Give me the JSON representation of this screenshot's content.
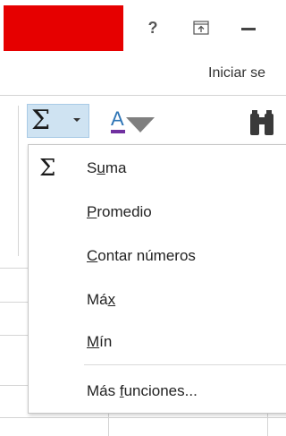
{
  "titlebar": {
    "help_icon_glyph": "?",
    "icons": [
      "help-icon",
      "ribbon-display-options-icon",
      "minimize-icon"
    ],
    "brand_block_color": "#e60000"
  },
  "account": {
    "sign_in_label": "Iniciar se"
  },
  "ribbon": {
    "autosum_icon": "sigma-icon",
    "fill_icon": "fill-down-icon",
    "find_icon": "binoculars-icon",
    "autosum_glyph": "Σ",
    "highlight_color": "#cfe3f2"
  },
  "menu": {
    "items": [
      {
        "id": "sum",
        "pre": "S",
        "ul": "u",
        "post": "ma",
        "icon": "sigma-icon",
        "glyph": "Σ"
      },
      {
        "id": "average",
        "pre": "",
        "ul": "P",
        "post": "romedio"
      },
      {
        "id": "count",
        "pre": "",
        "ul": "C",
        "post": "ontar números"
      },
      {
        "id": "max",
        "pre": "Má",
        "ul": "x",
        "post": ""
      },
      {
        "id": "min",
        "pre": "",
        "ul": "M",
        "post": "ín"
      },
      {
        "id": "more",
        "pre": "Más ",
        "ul": "f",
        "post": "unciones..."
      }
    ]
  }
}
